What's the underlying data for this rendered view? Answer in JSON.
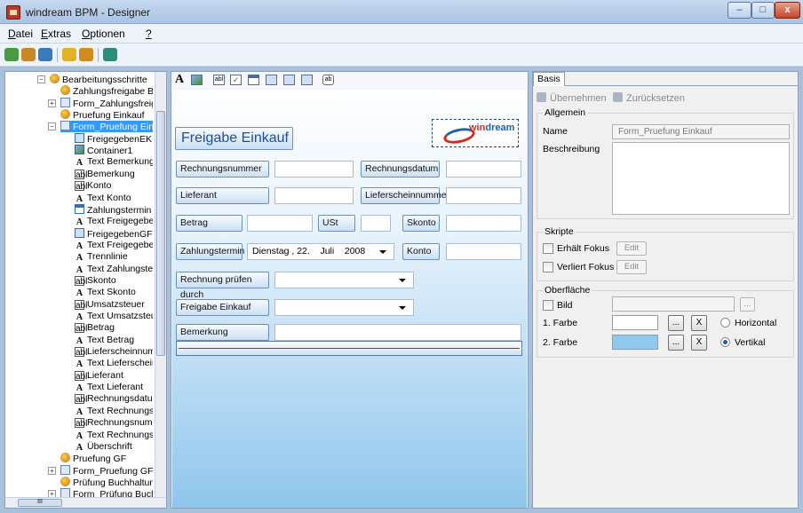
{
  "window": {
    "title": "windream BPM - Designer",
    "min": "–",
    "max": "□",
    "close": "x"
  },
  "menu": [
    {
      "u": "D",
      "rest": "atei"
    },
    {
      "u": "E",
      "rest": "xtras"
    },
    {
      "u": "O",
      "rest": "ptionen"
    },
    {
      "u": "?",
      "rest": ""
    }
  ],
  "tree": {
    "rows": [
      {
        "label": "Bearbeitungsschritte",
        "icon": "phase-icon"
      },
      {
        "label": "Zahlungsfreigabe Buc",
        "icon": "phase-icon"
      },
      {
        "label": "Form_Zahlungsfreigat",
        "icon": "form-icon"
      },
      {
        "label": "Pruefung Einkauf",
        "icon": "phase-icon"
      },
      {
        "label": "Form_Pruefung Einka",
        "icon": "form-icon"
      },
      {
        "label": "FreigegebenEK",
        "icon": "control-icon"
      },
      {
        "label": "Container1",
        "icon": "image-icon"
      },
      {
        "label": "Text Bemerkung",
        "icon": "text-icon"
      },
      {
        "label": "Bemerkung",
        "icon": "textbox-icon"
      },
      {
        "label": "Konto",
        "icon": "textbox-icon"
      },
      {
        "label": "Text Konto",
        "icon": "text-icon"
      },
      {
        "label": "Zahlungstermin",
        "icon": "date-icon"
      },
      {
        "label": "Text Freigegeben",
        "icon": "text-icon"
      },
      {
        "label": "FreigegebenGF",
        "icon": "control-icon"
      },
      {
        "label": "Text Freigegeben",
        "icon": "text-icon"
      },
      {
        "label": "Trennlinie",
        "icon": "text-icon"
      },
      {
        "label": "Text Zahlungsterr",
        "icon": "text-icon"
      },
      {
        "label": "Skonto",
        "icon": "textbox-icon"
      },
      {
        "label": "Text Skonto",
        "icon": "text-icon"
      },
      {
        "label": "Umsatzsteuer",
        "icon": "textbox-icon"
      },
      {
        "label": "Text Umsatzsteue",
        "icon": "text-icon"
      },
      {
        "label": "Betrag",
        "icon": "textbox-icon"
      },
      {
        "label": "Text Betrag",
        "icon": "text-icon"
      },
      {
        "label": "Lieferscheinnumr",
        "icon": "textbox-icon"
      },
      {
        "label": "Text Lieferschein",
        "icon": "text-icon"
      },
      {
        "label": "Lieferant",
        "icon": "textbox-icon"
      },
      {
        "label": "Text Lieferant",
        "icon": "text-icon"
      },
      {
        "label": "Rechnungsdatum",
        "icon": "textbox-icon"
      },
      {
        "label": "Text Rechnungsc",
        "icon": "text-icon"
      },
      {
        "label": "Rechnungsnumm",
        "icon": "textbox-icon"
      },
      {
        "label": "Text Rechnungsr",
        "icon": "text-icon"
      },
      {
        "label": "Überschrift",
        "icon": "text-icon"
      },
      {
        "label": "Pruefung GF",
        "icon": "phase-icon"
      },
      {
        "label": "Form_Pruefung GF",
        "icon": "form-icon"
      },
      {
        "label": "Prüfung Buchhaltung",
        "icon": "phase-icon"
      },
      {
        "label": "Form_Prüfung Buchh",
        "icon": "form-icon"
      }
    ],
    "scroll_glyph": "III"
  },
  "form": {
    "heading": "Freigabe Einkauf",
    "logo_text_a": "win",
    "logo_text_b": "dream",
    "rechnungsnummer": "Rechnungsnummer",
    "rechnungsdatum": "Rechnungsdatum",
    "lieferant": "Lieferant",
    "lieferscheinnummer": "Lieferscheinnummer",
    "betrag": "Betrag",
    "ust": "USt",
    "skonto": "Skonto",
    "zahlungstermin": "Zahlungstermin",
    "date_value": "Dienstag , 22.    Juli    2008",
    "konto": "Konto",
    "rechnung_pruefen": "Rechnung prüfen durch",
    "freigabe_einkauf": "Freigabe Einkauf",
    "bemerkung": "Bemerkung"
  },
  "props": {
    "tab": "Basis",
    "apply": "Übernehmen",
    "reset": "Zurücksetzen",
    "group_general": "Allgemein",
    "name_label": "Name",
    "name_value": "Form_Pruefung Einkauf",
    "desc_label": "Beschreibung",
    "group_scripts": "Skripte",
    "focus_get": "Erhält Fokus",
    "focus_lose": "Verliert Fokus",
    "edit": "Edit",
    "group_surface": "Oberfläche",
    "image": "Bild",
    "color1": "1. Farbe",
    "color2": "2. Farbe",
    "dots": "...",
    "x": "X",
    "horizontal": "Horizontal",
    "vertikal": "Vertikal",
    "color1_value": "#ffffff",
    "color2_value": "#8fc9ee",
    "gradient_direction": "Vertikal"
  }
}
